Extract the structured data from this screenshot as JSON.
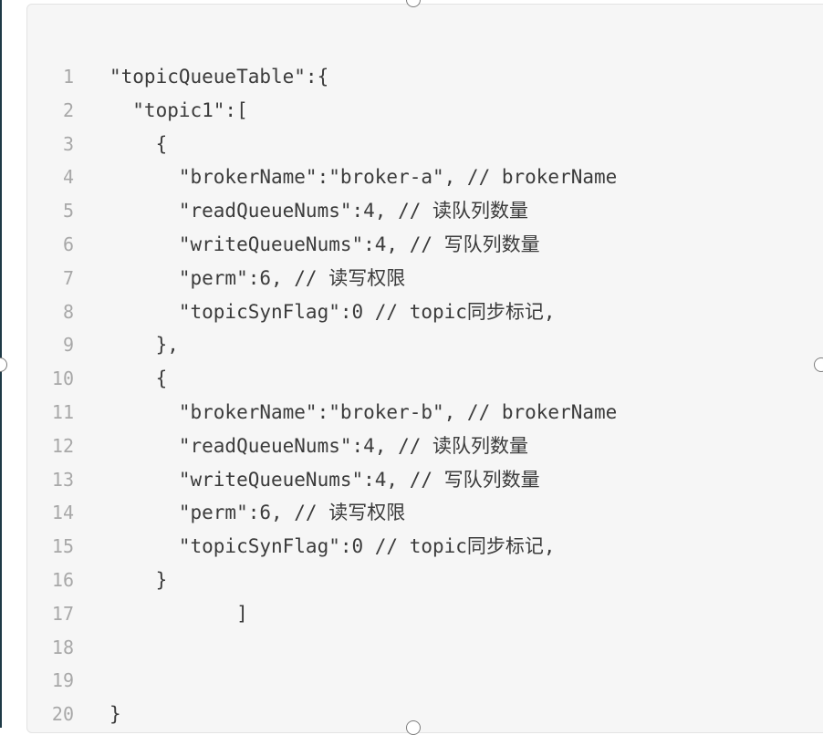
{
  "code_block": {
    "lines": [
      {
        "num": "1",
        "text": "\"topicQueueTable\":{"
      },
      {
        "num": "2",
        "text": "  \"topic1\":["
      },
      {
        "num": "3",
        "text": "    {"
      },
      {
        "num": "4",
        "text": "      \"brokerName\":\"broker-a\", // brokerName"
      },
      {
        "num": "5",
        "text": "      \"readQueueNums\":4, // 读队列数量"
      },
      {
        "num": "6",
        "text": "      \"writeQueueNums\":4, // 写队列数量"
      },
      {
        "num": "7",
        "text": "      \"perm\":6, // 读写权限"
      },
      {
        "num": "8",
        "text": "      \"topicSynFlag\":0 // topic同步标记,"
      },
      {
        "num": "9",
        "text": "    },"
      },
      {
        "num": "10",
        "text": "    {"
      },
      {
        "num": "11",
        "text": "      \"brokerName\":\"broker-b\", // brokerName"
      },
      {
        "num": "12",
        "text": "      \"readQueueNums\":4, // 读队列数量"
      },
      {
        "num": "13",
        "text": "      \"writeQueueNums\":4, // 写队列数量"
      },
      {
        "num": "14",
        "text": "      \"perm\":6, // 读写权限"
      },
      {
        "num": "15",
        "text": "      \"topicSynFlag\":0 // topic同步标记,"
      },
      {
        "num": "16",
        "text": "    }"
      },
      {
        "num": "17",
        "text": "           ]"
      },
      {
        "num": "18",
        "text": ""
      },
      {
        "num": "19",
        "text": ""
      },
      {
        "num": "20",
        "text": "}"
      }
    ]
  }
}
